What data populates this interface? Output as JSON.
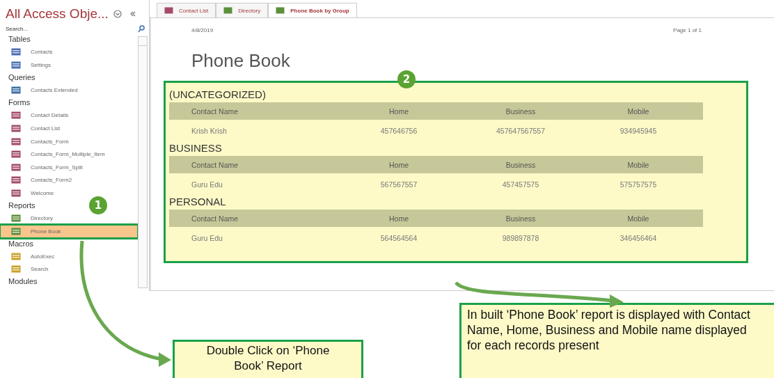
{
  "navigation_pane": {
    "title": "All Access Obje...",
    "search": {
      "placeholder": "Search..."
    },
    "groups": [
      {
        "name": "Tables",
        "items": [
          {
            "label": "Contacts",
            "kind": "table",
            "selected": false
          },
          {
            "label": "Settings",
            "kind": "table",
            "selected": false
          }
        ]
      },
      {
        "name": "Queries",
        "items": [
          {
            "label": "Contacts Extended",
            "kind": "query",
            "selected": false
          }
        ]
      },
      {
        "name": "Forms",
        "items": [
          {
            "label": "Contact Details",
            "kind": "form",
            "selected": false
          },
          {
            "label": "Contact List",
            "kind": "form",
            "selected": false
          },
          {
            "label": "Contacts_Form",
            "kind": "form",
            "selected": false
          },
          {
            "label": "Contacts_Form_Multiple_Item",
            "kind": "form",
            "selected": false
          },
          {
            "label": "Contacts_Form_Split",
            "kind": "form",
            "selected": false
          },
          {
            "label": "Contacts_Form2",
            "kind": "form",
            "selected": false
          },
          {
            "label": "Welcome",
            "kind": "form",
            "selected": false
          }
        ]
      },
      {
        "name": "Reports",
        "items": [
          {
            "label": "Directory",
            "kind": "report",
            "selected": false
          },
          {
            "label": "Phone Book",
            "kind": "report",
            "selected": true
          }
        ]
      },
      {
        "name": "Macros",
        "items": [
          {
            "label": "AutoExec",
            "kind": "macro",
            "selected": false
          },
          {
            "label": "Search",
            "kind": "macro",
            "selected": false
          }
        ]
      },
      {
        "name": "Modules"
      }
    ]
  },
  "tabs": [
    {
      "label": "Contact List",
      "kind": "form",
      "selected": false
    },
    {
      "label": "Directory",
      "kind": "report",
      "selected": false
    },
    {
      "label": "Phone Book by Group",
      "kind": "report",
      "selected": true
    }
  ],
  "report": {
    "date": "4/8/2019",
    "page": "Page 1 of 1",
    "title": "Phone Book",
    "groups": [
      {
        "name": "(UNCATEGORIZED)",
        "columns": [
          "Contact Name",
          "Home",
          "Business",
          "Mobile"
        ],
        "rows": [
          [
            "Krish Krish",
            "457646756",
            "457647567557",
            "934945945"
          ]
        ]
      },
      {
        "name": "BUSINESS",
        "columns": [
          "Contact Name",
          "Home",
          "Business",
          "Mobile"
        ],
        "rows": [
          [
            "Guru Edu",
            "567567557",
            "457457575",
            "575757575"
          ]
        ]
      },
      {
        "name": "PERSONAL",
        "columns": [
          "Contact Name",
          "Home",
          "Business",
          "Mobile"
        ],
        "rows": [
          [
            "Guru Edu",
            "564564564",
            "989897878",
            "346456464"
          ]
        ]
      }
    ]
  },
  "annotations": {
    "markers": [
      "1",
      "2"
    ],
    "callouts": [
      "Double Click on ‘Phone Book’ Report",
      "In built ‘Phone Book’ report is displayed with Contact Name, Home, Business and Mobile name displayed for each records present"
    ]
  }
}
